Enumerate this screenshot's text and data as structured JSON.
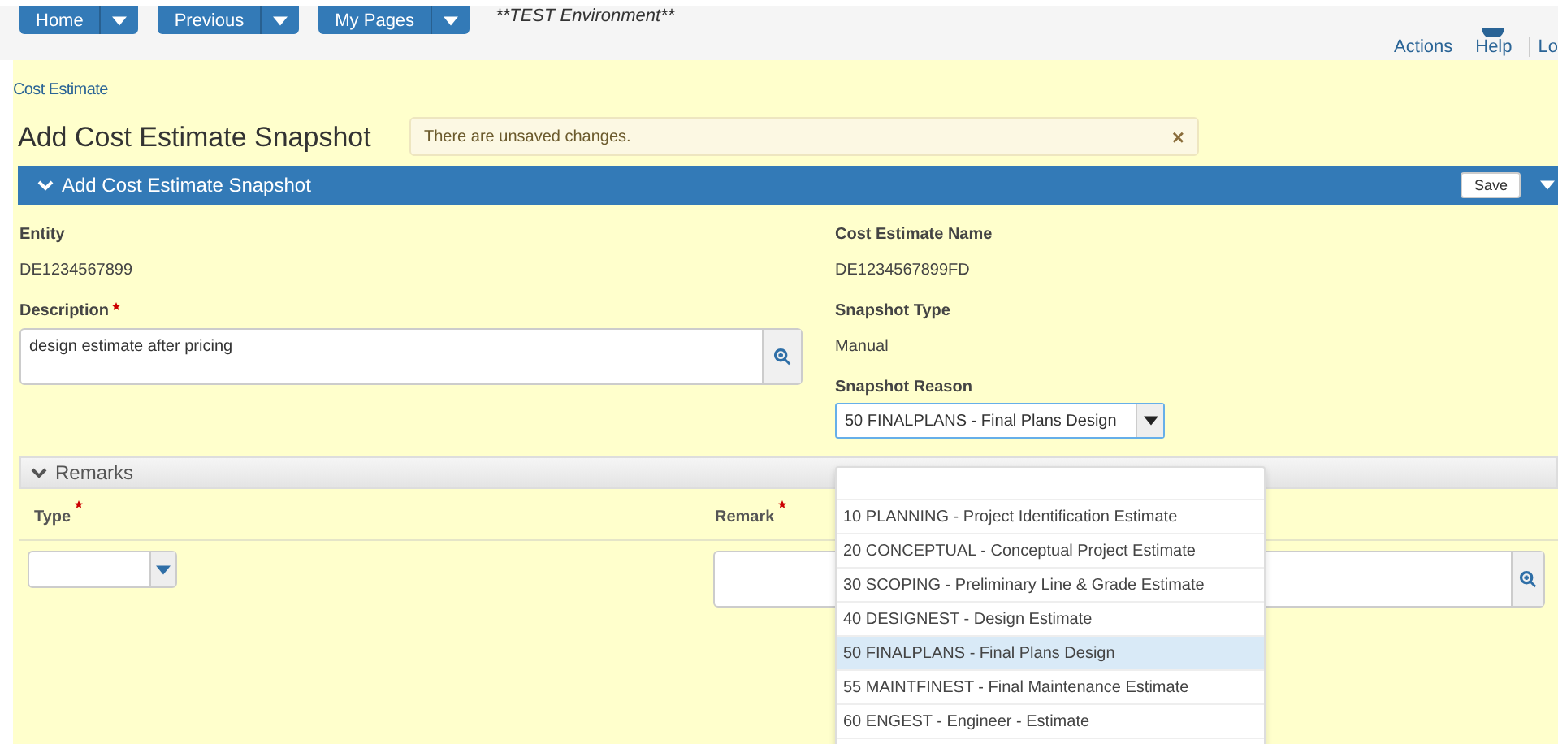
{
  "nav": {
    "buttons": [
      {
        "label": "Home"
      },
      {
        "label": "Previous"
      },
      {
        "label": "My Pages"
      }
    ],
    "environment": "**TEST Environment**",
    "links": [
      {
        "label": "Actions",
        "kind": "text"
      },
      {
        "label": "Help",
        "kind": "icon"
      },
      {
        "label": "Lo",
        "kind": "cut"
      }
    ]
  },
  "breadcrumb": "Cost Estimate",
  "page_title": "Add Cost Estimate Snapshot",
  "alert": {
    "message": "There are unsaved changes.",
    "close": "×"
  },
  "panel": {
    "title": "Add Cost Estimate Snapshot",
    "expanded": true,
    "save": "Save"
  },
  "fields": {
    "entity": {
      "label": "Entity",
      "value": "DE1234567899"
    },
    "cost_estimate_name": {
      "label": "Cost Estimate Name",
      "value": "DE1234567899FD"
    },
    "description": {
      "label": "Description",
      "required": true,
      "value": "design estimate after pricing"
    },
    "snapshot_type": {
      "label": "Snapshot Type",
      "value": "Manual"
    },
    "snapshot_reason": {
      "label": "Snapshot Reason",
      "value": "50 FINALPLANS - Final Plans Design",
      "expanded": true
    }
  },
  "remarks": {
    "title": "Remarks",
    "expanded": true,
    "columns": [
      {
        "label": "Type",
        "required": true
      },
      {
        "label": "Remark",
        "required": true
      }
    ]
  },
  "reason_options": [
    {
      "label": "10 PLANNING - Project Identification Estimate",
      "selected": false
    },
    {
      "label": "20 CONCEPTUAL - Conceptual Project Estimate",
      "selected": false
    },
    {
      "label": "30 SCOPING - Preliminary Line & Grade Estimate",
      "selected": false
    },
    {
      "label": "40 DESIGNEST - Design Estimate",
      "selected": false
    },
    {
      "label": "50 FINALPLANS - Final Plans Design",
      "selected": true
    },
    {
      "label": "55 MAINTFINEST - Final Maintenance Estimate",
      "selected": false
    },
    {
      "label": "60 ENGEST - Engineer - Estimate",
      "selected": false
    }
  ]
}
